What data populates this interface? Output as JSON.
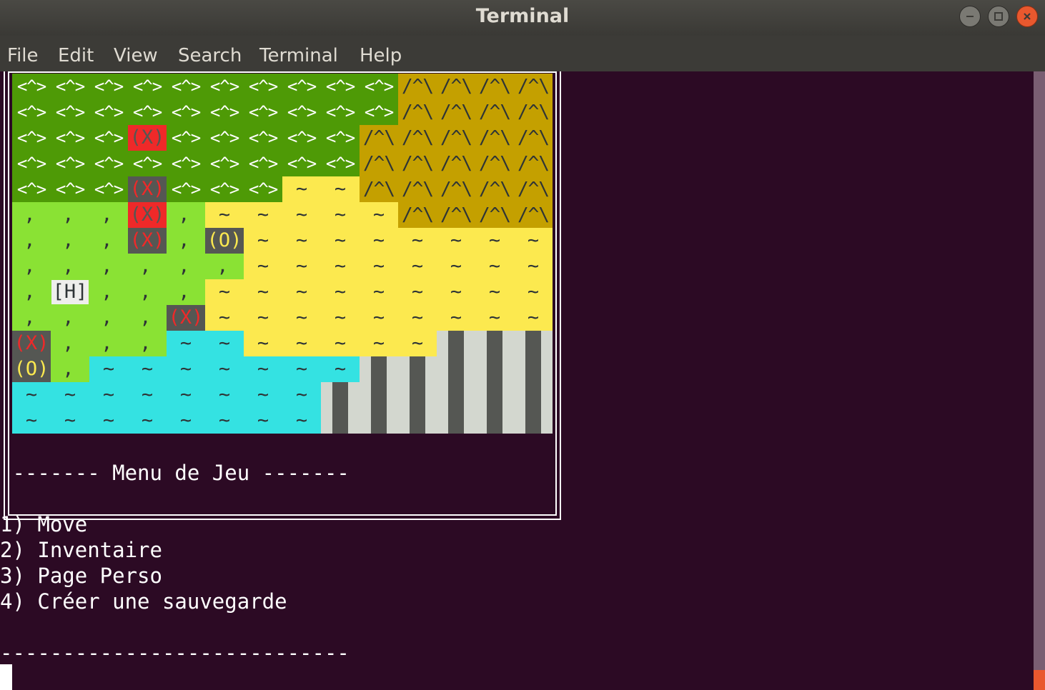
{
  "window": {
    "title": "Terminal"
  },
  "menubar": {
    "items": [
      "File",
      "Edit",
      "View",
      "Search",
      "Terminal",
      "Help"
    ]
  },
  "colors": {
    "forest": "#4e9a06",
    "grass": "#8ae234",
    "sand": "#fce94f",
    "water": "#34e2e2",
    "mountain": "#c4a000",
    "rock": "#d3d7cf",
    "enemy": "#ef2929",
    "chest": "#fce94f",
    "terminal_bg": "#2c0a24",
    "close_button": "#e9582e"
  },
  "map": {
    "tile_text": {
      "F": "<^>",
      "G": " , '",
      "S": "~",
      "W": "~",
      "M": "/^\\",
      "E": "(X)",
      "ER": "(X)",
      "C": "(O)",
      "H": "[H]",
      "R": ""
    },
    "rows": [
      [
        "F",
        "F",
        "F",
        "F",
        "F",
        "F",
        "F",
        "F",
        "F",
        "F",
        "M",
        "M",
        "M",
        "M"
      ],
      [
        "F",
        "F",
        "F",
        "F",
        "F",
        "F",
        "F",
        "F",
        "F",
        "F",
        "M",
        "M",
        "M",
        "M"
      ],
      [
        "F",
        "F",
        "F",
        "ER",
        "F",
        "F",
        "F",
        "F",
        "F",
        "M",
        "M",
        "M",
        "M",
        "M"
      ],
      [
        "F",
        "F",
        "F",
        "F",
        "F",
        "F",
        "F",
        "F",
        "F",
        "M",
        "M",
        "M",
        "M",
        "M"
      ],
      [
        "F",
        "F",
        "F",
        "E",
        "F",
        "F",
        "F",
        "S",
        "S",
        "M",
        "M",
        "M",
        "M",
        "M"
      ],
      [
        "G",
        "G",
        "G",
        "ER",
        "G",
        "S",
        "S",
        "S",
        "S",
        "S",
        "M",
        "M",
        "M",
        "M"
      ],
      [
        "G",
        "G",
        "G",
        "E",
        "G",
        "C",
        "S",
        "S",
        "S",
        "S",
        "S",
        "S",
        "S",
        "S"
      ],
      [
        "G",
        "G",
        "G",
        "G",
        "G",
        "G",
        "S",
        "S",
        "S",
        "S",
        "S",
        "S",
        "S",
        "S"
      ],
      [
        "G",
        "H",
        "G",
        "G",
        "G",
        "S",
        "S",
        "S",
        "S",
        "S",
        "S",
        "S",
        "S",
        "S"
      ],
      [
        "G",
        "G",
        "G",
        "G",
        "E",
        "S",
        "S",
        "S",
        "S",
        "S",
        "S",
        "S",
        "S",
        "S"
      ],
      [
        "E",
        "G",
        "G",
        "G",
        "W",
        "W",
        "S",
        "S",
        "S",
        "S",
        "S",
        "R",
        "R",
        "R"
      ],
      [
        "C",
        "G",
        "W",
        "W",
        "W",
        "W",
        "W",
        "W",
        "W",
        "R",
        "R",
        "R",
        "R",
        "R"
      ],
      [
        "W",
        "W",
        "W",
        "W",
        "W",
        "W",
        "W",
        "W",
        "R",
        "R",
        "R",
        "R",
        "R",
        "R"
      ],
      [
        "W",
        "W",
        "W",
        "W",
        "W",
        "W",
        "W",
        "W",
        "R",
        "R",
        "R",
        "R",
        "R",
        "R"
      ]
    ]
  },
  "game_menu": {
    "header": " ------- Menu de Jeu -------",
    "options": [
      "1) Move",
      "2) Inventaire",
      "3) Page Perso",
      "4) Créer une sauvegarde"
    ],
    "footer": "----------------------------"
  }
}
